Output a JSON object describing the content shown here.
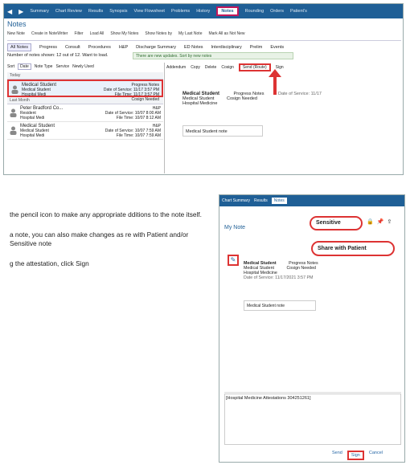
{
  "nav": {
    "items": [
      "Summary",
      "Chart Review",
      "Results",
      "Synopsis",
      "View Flowsheet",
      "Problems",
      "History",
      "Notes",
      "Rounding",
      "Orders",
      "Patient's"
    ],
    "notes_label": "Notes"
  },
  "notes": {
    "title": "Notes",
    "toolbar": [
      "New Note",
      "Create in NoteWriter",
      "Filter",
      "Load All",
      "Show My Notes",
      "Show Notes by",
      "My Last Note",
      "Mark All as Not New"
    ],
    "tabs": [
      "All Notes",
      "Progress",
      "Consult",
      "Procedures",
      "H&P",
      "Discharge Summary",
      "ED Notes",
      "Interdisciplinary",
      "Prelim",
      "Events"
    ],
    "count_text": "Number of notes shown: 12 out of 12.  Want to load.",
    "updates_text": "There are new updates. Sort by new notes",
    "sortbar": [
      "Sort",
      "Date",
      "Note Type",
      "Service",
      "Newly Used"
    ],
    "groups": [
      {
        "label": "Today",
        "items": [
          {
            "name": "Medical Student",
            "role": "Medical Student",
            "svc": "Hospital Medi",
            "type": "Progress Notes",
            "dos": "Date of Service: 11/17 3:57 PM",
            "ft": "File Time: 11/17 3:57 PM",
            "status": "Cosign Needed"
          }
        ]
      },
      {
        "label": "Last Month",
        "items": [
          {
            "name": "Peter Bradford Co...",
            "role": "Resident",
            "svc": "Hospital Medi",
            "type": "H&P",
            "dos": "Date of Service: 10/07 8:00 AM",
            "ft": "File Time: 10/07 8:12 AM",
            "status": ""
          },
          {
            "name": "Medical Student",
            "role": "Medical Student",
            "svc": "Hospital Medi",
            "type": "H&P",
            "dos": "Date of Service: 10/07 7:59 AM",
            "ft": "File Time: 10/07 7:59 AM",
            "status": ""
          }
        ]
      }
    ],
    "right_toolbar": [
      "Addendum",
      "Copy",
      "Delete",
      "Cosign",
      "Send (Route)",
      "Sign"
    ],
    "send_label": "Send (Route)",
    "note": {
      "author": "Medical Student",
      "type": "Progress Notes",
      "role": "Medical Student",
      "status": "Cosign Needed",
      "svc": "Hospital Medicine",
      "dos": "Date of Service: 11/17"
    },
    "body": "Medical Student note"
  },
  "instructions": [
    "the pencil icon to make any appropriate dditions to the note itself.",
    "a note, you can also make changes as re with Patient and/or Sensitive note",
    "g the attestation, click Sign"
  ],
  "shot2": {
    "nav": [
      "Chart Summary",
      "Results",
      "Notes"
    ],
    "title": "My Note",
    "sensitive_label": "Sensitive",
    "share_label": "Share with Patient",
    "note_author": "Medical Student",
    "note_type": "Progress Notes",
    "note_role": "Medical Student",
    "note_status": "Cosign Needed",
    "note_svc": "Hospital Medicine",
    "note_dos": "Date of Service: 11/17/2021 3:57 PM",
    "body": "Medical Student note",
    "attestation": "[Hospital Medicine Attestations 304251261]",
    "buttons": {
      "send": "Send",
      "sign": "Sign",
      "cancel": "Cancel"
    }
  }
}
